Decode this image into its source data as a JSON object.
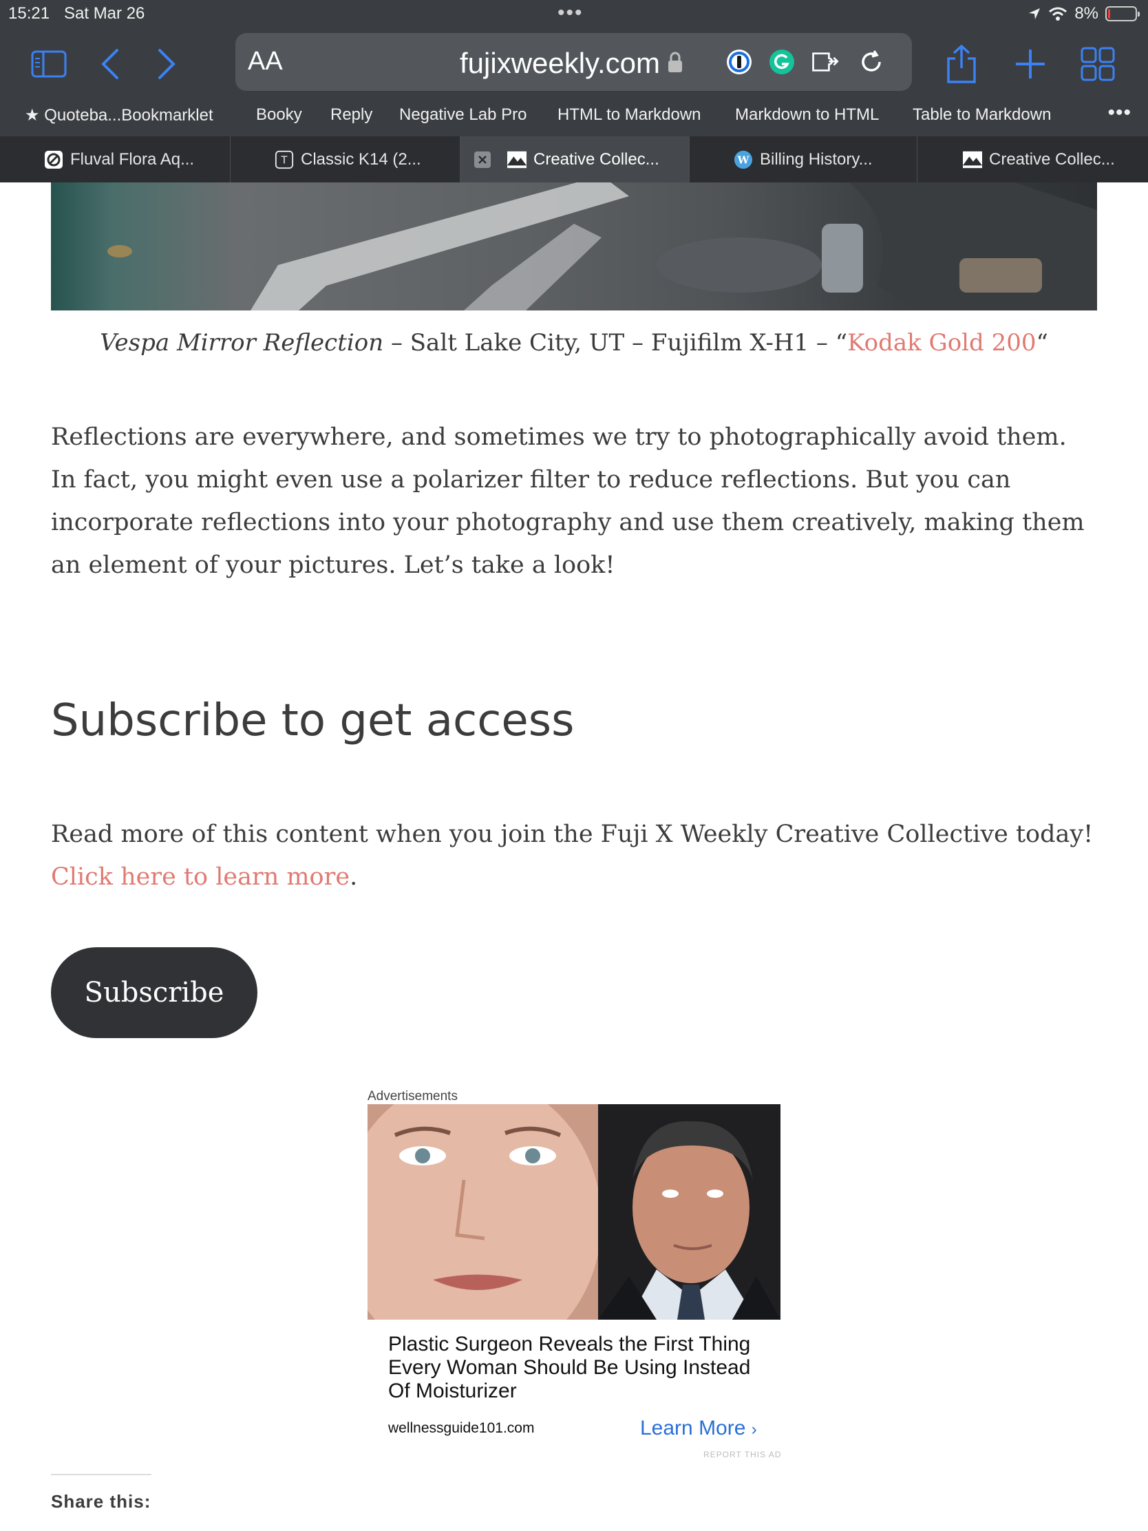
{
  "status_bar": {
    "time": "15:21",
    "date": "Sat Mar 26",
    "battery": "8%",
    "battery_level": 0.08
  },
  "toolbar": {
    "text_size_label": "AA",
    "url": "fujixweekly.com"
  },
  "bookmarks": [
    "Quoteba...Bookmarklet",
    "Booky",
    "Reply",
    "Negative Lab Pro",
    "HTML to Markdown",
    "Markdown to HTML",
    "Table to Markdown"
  ],
  "tabs": [
    {
      "label": "Fluval Flora Aq..."
    },
    {
      "label": "Classic K14 (2..."
    },
    {
      "label": "Creative Collec..."
    },
    {
      "label": "Billing History..."
    },
    {
      "label": "Creative Collec..."
    }
  ],
  "article": {
    "caption_title": "Vespa Mirror Reflection",
    "caption_meta": " – Salt Lake City, UT – Fujifilm X-H1 – “",
    "caption_link": "Kodak Gold 200",
    "caption_close": "“",
    "intro": "Reflections are everywhere, and sometimes we try to photographically avoid them. In fact, you might even use a polarizer filter to reduce reflections. But you can incorporate reflections into your photography and use them creatively, making them an element of your pictures. Let’s take a look!",
    "subscribe_heading": "Subscribe to get access",
    "subscribe_text": "Read more of this content when you join the Fuji X Weekly Creative Collective today! ",
    "subscribe_link": "Click here to learn more",
    "subscribe_period": ".",
    "subscribe_button": "Subscribe"
  },
  "ad": {
    "label": "Advertisements",
    "headline": "Plastic Surgeon Reveals the First Thing Every Woman Should Be Using Instead Of Moisturizer",
    "domain": "wellnessguide101.com",
    "cta": "Learn More",
    "report": "REPORT THIS AD"
  },
  "share": {
    "label": "Share this:"
  },
  "colors": {
    "chrome_bg": "#3a3d41",
    "link": "#e07a72",
    "accent_blue": "#3b82f6",
    "button_dark": "#303236",
    "ad_cta": "#2a6fd6"
  }
}
